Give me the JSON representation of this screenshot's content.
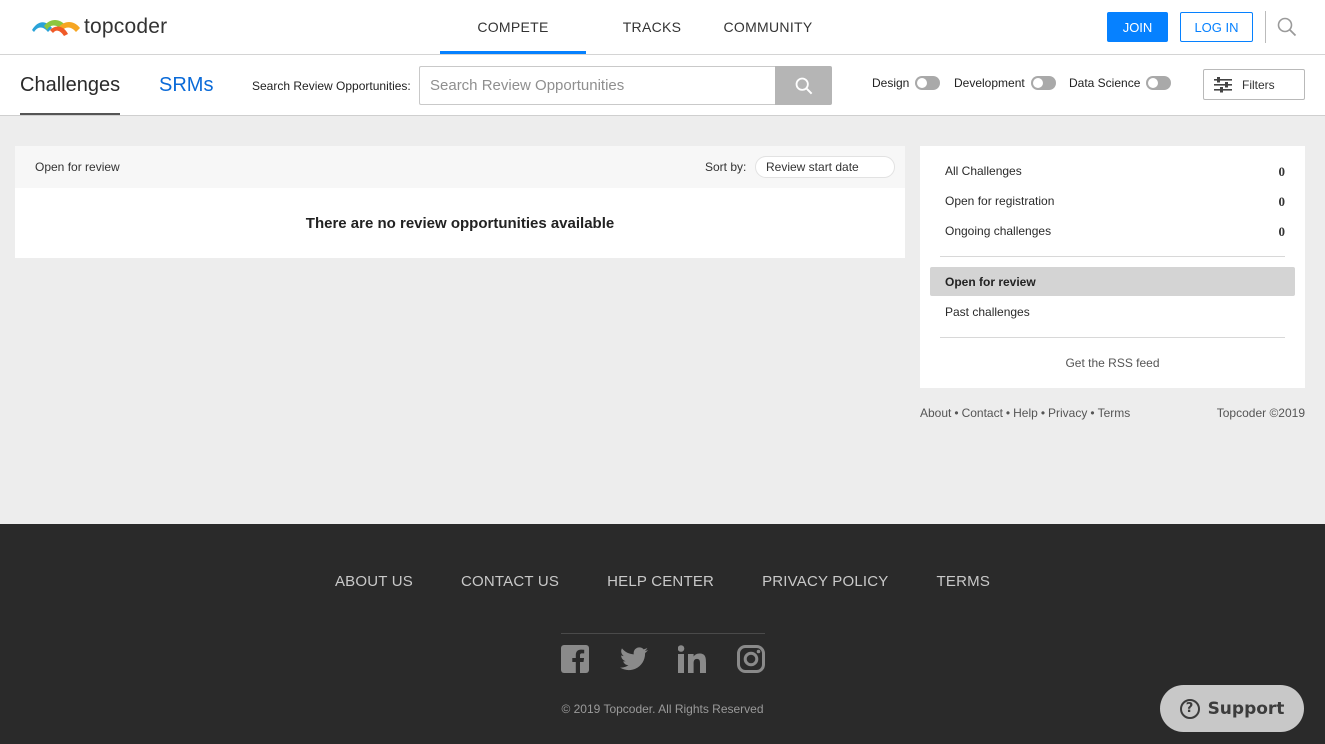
{
  "header": {
    "logo_text": "topcoder",
    "nav": [
      {
        "label": "COMPETE",
        "active": true
      },
      {
        "label": "TRACKS",
        "active": false
      },
      {
        "label": "COMMUNITY",
        "active": false
      }
    ],
    "join_label": "JOIN",
    "login_label": "LOG IN",
    "search_icon": "search-icon",
    "accent_color": "#0681ff"
  },
  "subheader": {
    "tab_challenges": "Challenges",
    "tab_srms": "SRMs",
    "search_label": "Search Review Opportunities:",
    "search_placeholder": "Search Review Opportunities",
    "tracks": [
      {
        "label": "Design",
        "on": false
      },
      {
        "label": "Development",
        "on": false
      },
      {
        "label": "Data Science",
        "on": false
      }
    ],
    "filters_label": "Filters"
  },
  "main": {
    "status_label": "Open for review",
    "sort_label": "Sort by:",
    "sort_value": "Review start date",
    "empty_message": "There are no review opportunities available"
  },
  "sidebar": {
    "buckets": [
      {
        "label": "All Challenges",
        "count": "0"
      },
      {
        "label": "Open for registration",
        "count": "0"
      },
      {
        "label": "Ongoing challenges",
        "count": "0"
      }
    ],
    "active_bucket": "Open for review",
    "past_bucket": "Past challenges",
    "rss_label": "Get the RSS feed",
    "footer_links": [
      "About",
      "Contact",
      "Help",
      "Privacy",
      "Terms"
    ],
    "copyright": "Topcoder ©2019"
  },
  "footer": {
    "links": [
      "ABOUT US",
      "CONTACT US",
      "HELP CENTER",
      "PRIVACY POLICY",
      "TERMS"
    ],
    "social": [
      "facebook-icon",
      "twitter-icon",
      "linkedin-icon",
      "instagram-icon"
    ],
    "copyright": "© 2019 Topcoder. All Rights Reserved",
    "background_color": "#2a2a2a"
  },
  "support": {
    "label": "Support",
    "icon_glyph": "?"
  }
}
